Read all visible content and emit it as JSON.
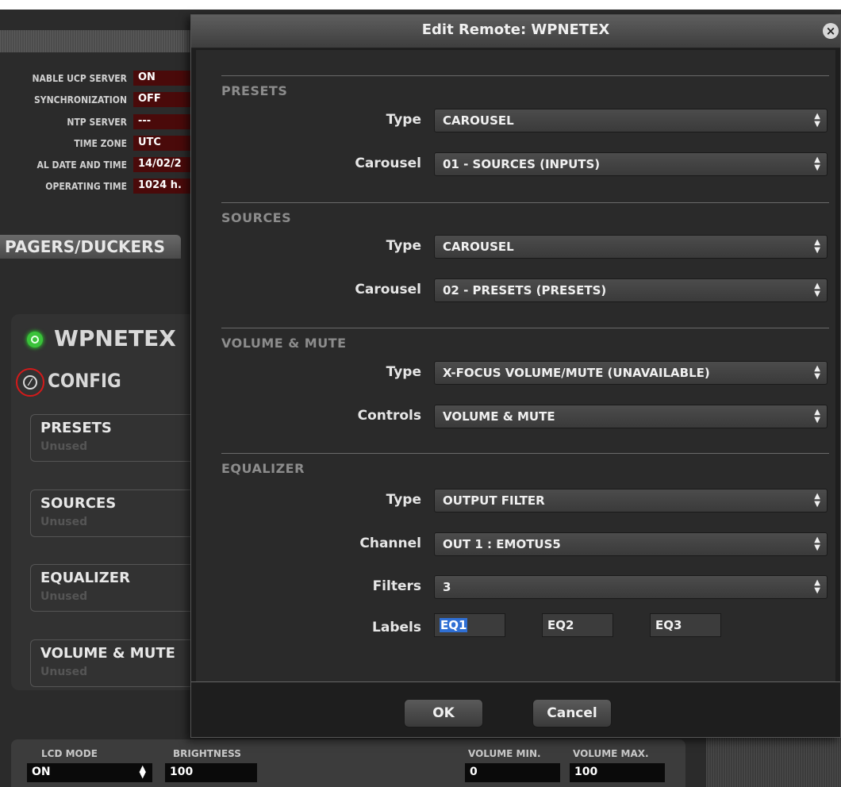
{
  "background": {
    "info_rows": [
      {
        "label": "NABLE UCP SERVER",
        "value": "ON"
      },
      {
        "label": "SYNCHRONIZATION",
        "value": "OFF"
      },
      {
        "label": "NTP SERVER",
        "value": "---"
      },
      {
        "label": "TIME ZONE",
        "value": "UTC"
      },
      {
        "label": "AL DATE AND TIME",
        "value": "14/02/2"
      },
      {
        "label": "OPERATING TIME",
        "value": "1024 h."
      }
    ],
    "tab_label": "PAGERS/DUCKERS",
    "device_name": "WPNETEX",
    "config_label": "CONFIG",
    "sections": [
      {
        "title": "PRESETS",
        "sub": "Unused"
      },
      {
        "title": "SOURCES",
        "sub": "Unused"
      },
      {
        "title": "EQUALIZER",
        "sub": "Unused"
      },
      {
        "title": "VOLUME & MUTE",
        "sub": "Unused"
      }
    ],
    "bottom": {
      "lcd_mode_label": "LCD MODE",
      "lcd_mode_value": "ON",
      "brightness_label": "BRIGHTNESS",
      "brightness_value": "100",
      "volume_min_label": "VOLUME MIN.",
      "volume_min_value": "0",
      "volume_max_label": "VOLUME MAX.",
      "volume_max_value": "100"
    }
  },
  "modal": {
    "title": "Edit Remote: WPNETEX",
    "groups": {
      "presets": {
        "title": "PRESETS",
        "type_label": "Type",
        "type_value": "CAROUSEL",
        "carousel_label": "Carousel",
        "carousel_value": "01 - SOURCES (INPUTS)"
      },
      "sources": {
        "title": "SOURCES",
        "type_label": "Type",
        "type_value": "CAROUSEL",
        "carousel_label": "Carousel",
        "carousel_value": "02 - PRESETS (PRESETS)"
      },
      "volume": {
        "title": "VOLUME & MUTE",
        "type_label": "Type",
        "type_value": "X-FOCUS VOLUME/MUTE (UNAVAILABLE)",
        "controls_label": "Controls",
        "controls_value": "VOLUME & MUTE"
      },
      "equalizer": {
        "title": "EQUALIZER",
        "type_label": "Type",
        "type_value": "OUTPUT FILTER",
        "channel_label": "Channel",
        "channel_value": "OUT 1 : EMOTUS5",
        "filters_label": "Filters",
        "filters_value": "3",
        "labels_label": "Labels",
        "labels": [
          "EQ1",
          "EQ2",
          "EQ3"
        ]
      }
    },
    "ok_label": "OK",
    "cancel_label": "Cancel"
  }
}
